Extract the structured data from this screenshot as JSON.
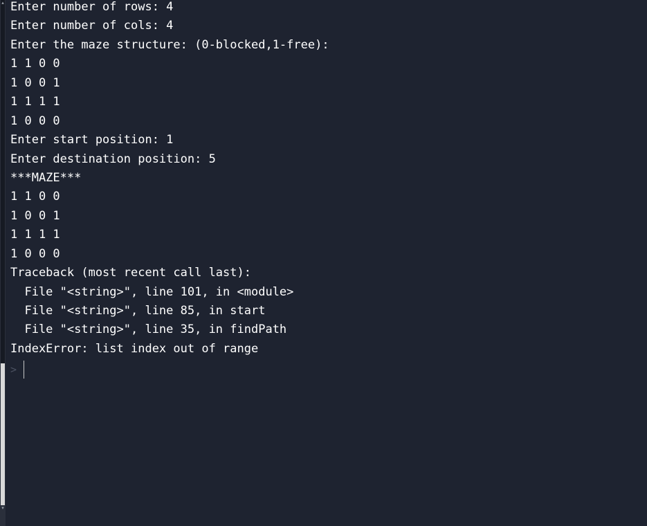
{
  "console": {
    "lines": [
      "Enter number of rows: 4",
      "Enter number of cols: 4",
      "Enter the maze structure: (0-blocked,1-free):",
      "1 1 0 0",
      "1 0 0 1",
      "1 1 1 1",
      "1 0 0 0",
      "Enter start position: 1",
      "Enter destination position: 5",
      "***MAZE***",
      "1 1 0 0",
      "1 0 0 1",
      "1 1 1 1",
      "1 0 0 0",
      "Traceback (most recent call last):",
      "  File \"<string>\", line 101, in <module>",
      "  File \"<string>\", line 85, in start",
      "  File \"<string>\", line 35, in findPath",
      "IndexError: list index out of range"
    ],
    "prompt_symbol": ">"
  },
  "colors": {
    "background": "#1e2330",
    "text": "#ffffff",
    "prompt": "#4c5262"
  }
}
